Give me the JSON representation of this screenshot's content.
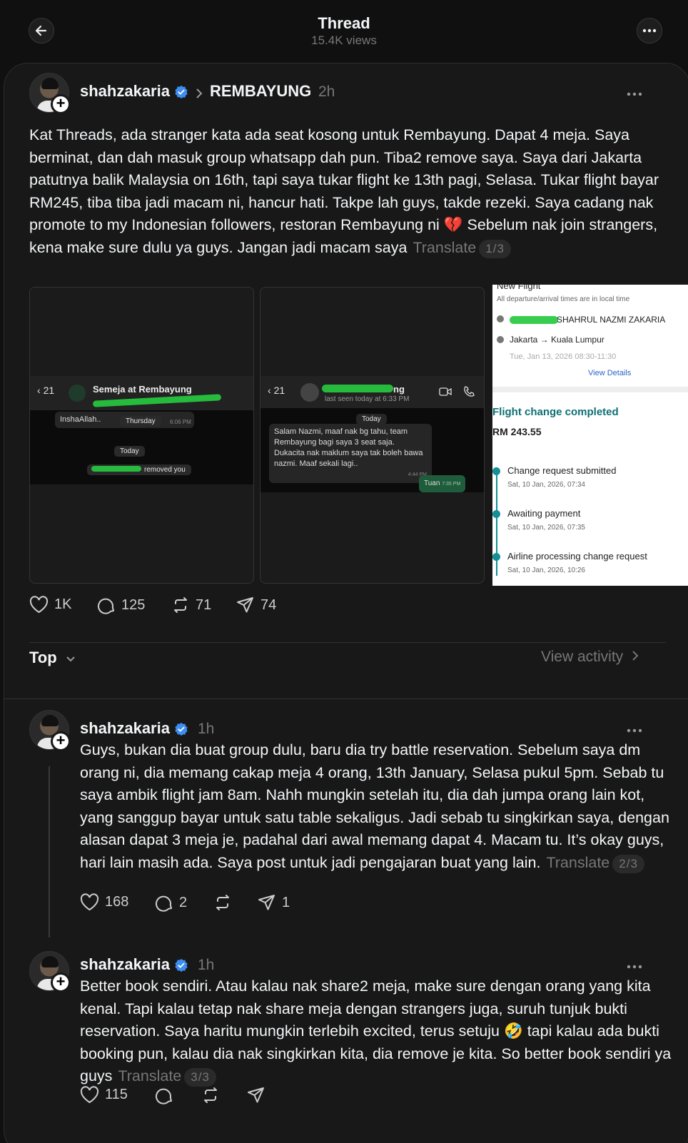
{
  "header": {
    "title": "Thread",
    "views": "15.4K views"
  },
  "post": {
    "username": "shahzakaria",
    "community": "REMBAYUNG",
    "time": "2h",
    "text": "Kat Threads, ada stranger kata ada seat kosong untuk Rembayung. Dapat 4 meja. Saya berminat, dan dah masuk group whatsapp dah pun. Tiba2 remove saya. Saya dari Jakarta patutnya balik Malaysia on 16th, tapi saya tukar flight ke 13th pagi, Selasa. Tukar flight bayar RM245, tiba tiba jadi macam ni, hancur hati. Takpe lah guys, takde rezeki. Saya cadang nak promote to my Indonesian followers, restoran Rembayung ni 💔 Sebelum nak join strangers, kena make sure dulu ya guys. Jangan jadi macam saya",
    "translate": "Translate",
    "pager": "1/3",
    "likes": "1K",
    "comments": "125",
    "reposts": "71",
    "shares": "74"
  },
  "images": {
    "group_chat": {
      "back_count": "21",
      "title": "Semeja at Rembayung",
      "message": "InshaAllah..",
      "day_pill": "Thursday",
      "msg_time": "6:06 PM",
      "today_pill": "Today",
      "removed_text": "removed you"
    },
    "dm_chat": {
      "back_count": "21",
      "title_suffix": "ng",
      "last_seen": "last seen today at 6:33 PM",
      "today_pill": "Today",
      "message": "Salam Nazmi, maaf nak bg tahu, team Rembayung bagi saya 3 seat saja. Dukacita nak maklum saya tak boleh bawa nazmi. Maaf sekali lagi..",
      "msg_time": "4:44 PM",
      "reply": "Tuan",
      "reply_time": "7:35 PM"
    },
    "flight": {
      "heading": "New Flight",
      "note": "All departure/arrival times are in local time",
      "passenger": "SHAHRUL NAZMI ZAKARIA",
      "route": "Jakarta → Kuala Lumpur",
      "date": "Tue, Jan 13, 2026 08:30-11:30",
      "view_details": "View Details",
      "status_title": "Flight change completed",
      "amount": "RM 243.55",
      "steps": [
        {
          "label": "Change request submitted",
          "time": "Sat, 10 Jan, 2026, 07:34"
        },
        {
          "label": "Awaiting payment",
          "time": "Sat, 10 Jan, 2026, 07:35"
        },
        {
          "label": "Airline processing change request",
          "time": "Sat, 10 Jan, 2026, 10:26"
        }
      ]
    }
  },
  "sort": {
    "label": "Top",
    "view_activity": "View activity"
  },
  "replies": [
    {
      "username": "shahzakaria",
      "time": "1h",
      "text": "Guys, bukan dia buat group dulu, baru dia try battle reservation. Sebelum saya dm orang ni, dia memang cakap meja 4 orang, 13th January, Selasa pukul 5pm. Sebab tu saya ambik flight jam 8am. Nahh mungkin setelah itu, dia dah jumpa orang lain kot, yang sanggup bayar untuk satu table sekaligus. Jadi sebab tu singkirkan saya, dengan alasan dapat 3 meja je, padahal dari awal memang dapat 4. Macam tu. It’s okay guys, hari lain masih ada. Saya post untuk jadi pengajaran buat yang lain.",
      "translate": "Translate",
      "pager": "2/3",
      "likes": "168",
      "comments": "2",
      "shares": "1"
    },
    {
      "username": "shahzakaria",
      "time": "1h",
      "text": "Better book sendiri. Atau kalau nak share2 meja, make sure dengan orang yang kita kenal. Tapi kalau tetap nak share meja dengan strangers juga, suruh tunjuk bukti reservation. Saya haritu mungkin terlebih excited, terus setuju 🤣 tapi kalau ada bukti booking pun, kalau dia nak singkirkan kita, dia remove je kita. So better book sendiri ya guys",
      "translate": "Translate",
      "pager": "3/3",
      "likes": "115"
    }
  ],
  "colors": {
    "background": "#101010",
    "card": "#181818",
    "verified": "#3d8ef0",
    "muted": "#777777"
  }
}
